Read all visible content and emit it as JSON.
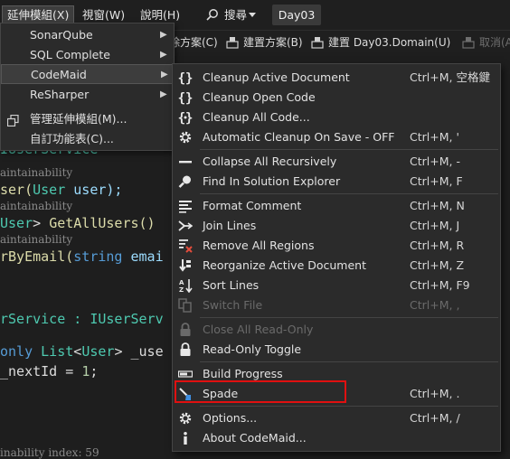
{
  "menubar": {
    "extensions": "延伸模組(X)",
    "window": "視窗(W)",
    "help": "說明(H)",
    "search": "搜尋",
    "project": "Day03"
  },
  "toolbar": {
    "clean": "除方案(C)",
    "build_project": "建置方案(B)",
    "build_domain": "建置 Day03.Domain(U)",
    "cancel": "取消(A"
  },
  "code": {
    "l1": "",
    "l2": "IUserService",
    "l3": "aintainability",
    "l4_a": "ser(",
    "l4_b": "User",
    "l4_c": " user);",
    "l5": "aintainability",
    "l6_a": "User",
    "l6_b": "> ",
    "l6_c": "GetAllUsers()",
    "l7": "aintainability",
    "l8_a": "rByEmail(",
    "l8_b": "string",
    "l8_c": " emai",
    "l9_a": "rService : IUserServ",
    "l10_a": "only ",
    "l10_b": "List",
    "l10_c": "<",
    "l10_d": "User",
    "l10_e": "> _use",
    "l11_a": "_nextId = ",
    "l11_b": "1",
    "l11_c": ";",
    "l12": "inability index: 59"
  },
  "menu1": {
    "items": [
      {
        "label": "SonarQube"
      },
      {
        "label": "SQL Complete"
      },
      {
        "label": "CodeMaid"
      },
      {
        "label": "ReSharper"
      },
      {
        "label": "管理延伸模組(M)..."
      },
      {
        "label": "自訂功能表(C)..."
      }
    ]
  },
  "menu2": {
    "items": [
      {
        "label": "Cleanup Active Document",
        "shortcut": "Ctrl+M, 空格鍵",
        "icon": "curly-braces-icon"
      },
      {
        "label": "Cleanup Open Code",
        "shortcut": "",
        "icon": "curly-braces-icon"
      },
      {
        "label": "Cleanup All Code...",
        "shortcut": "",
        "icon": "curly-braces-stars-icon"
      },
      {
        "label": "Automatic Cleanup On Save - OFF",
        "shortcut": "Ctrl+M, '",
        "icon": "gear-icon"
      },
      {
        "label": "Collapse All Recursively",
        "shortcut": "Ctrl+M, -",
        "icon": "minus-icon"
      },
      {
        "label": "Find In Solution Explorer",
        "shortcut": "Ctrl+M, F",
        "icon": "magnifier-icon"
      },
      {
        "label": "Format Comment",
        "shortcut": "Ctrl+M, N",
        "icon": "comment-format-icon"
      },
      {
        "label": "Join Lines",
        "shortcut": "Ctrl+M, J",
        "icon": "join-arrows-icon"
      },
      {
        "label": "Remove All Regions",
        "shortcut": "Ctrl+M, R",
        "icon": "remove-regions-icon"
      },
      {
        "label": "Reorganize Active Document",
        "shortcut": "Ctrl+M, Z",
        "icon": "reorganize-icon"
      },
      {
        "label": "Sort Lines",
        "shortcut": "Ctrl+M, F9",
        "icon": "sort-az-icon"
      },
      {
        "label": "Switch File",
        "shortcut": "Ctrl+M, ,",
        "icon": "switch-file-icon"
      },
      {
        "label": "Close All Read-Only",
        "shortcut": "",
        "icon": "lock-icon"
      },
      {
        "label": "Read-Only Toggle",
        "shortcut": "",
        "icon": "lock-icon"
      },
      {
        "label": "Build Progress",
        "shortcut": "",
        "icon": "progress-bar-icon"
      },
      {
        "label": "Spade",
        "shortcut": "Ctrl+M, .",
        "icon": "spade-icon"
      },
      {
        "label": "Options...",
        "shortcut": "Ctrl+M, /",
        "icon": "gear-icon"
      },
      {
        "label": "About CodeMaid...",
        "shortcut": "",
        "icon": "info-icon"
      }
    ]
  }
}
